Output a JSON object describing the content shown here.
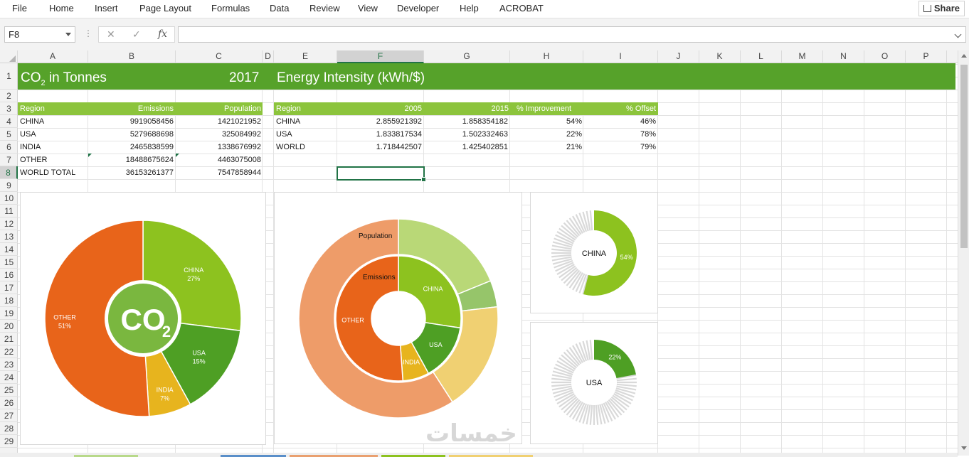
{
  "ribbon": {
    "tabs": [
      "File",
      "Home",
      "Insert",
      "Page Layout",
      "Formulas",
      "Data",
      "Review",
      "View",
      "Developer",
      "Help",
      "ACROBAT"
    ],
    "share": "Share"
  },
  "formula_bar": {
    "name_box": "F8",
    "cancel": "✕",
    "enter": "✓",
    "fx": "fx",
    "formula": ""
  },
  "columns": [
    "A",
    "B",
    "C",
    "D",
    "E",
    "F",
    "G",
    "H",
    "I",
    "J",
    "K",
    "L",
    "M",
    "N",
    "O",
    "P"
  ],
  "selected_column": "F",
  "rows": [
    "1",
    "2",
    "3",
    "4",
    "5",
    "6",
    "7",
    "8",
    "9",
    "10",
    "11",
    "12",
    "13",
    "14",
    "15",
    "16",
    "17",
    "18",
    "19",
    "20",
    "21",
    "22",
    "23",
    "24",
    "25",
    "26",
    "27",
    "28",
    "29"
  ],
  "selected_row": "8",
  "banner": {
    "co2_label": "CO",
    "co2_sub": "2",
    "co2_rest": " in Tonnes",
    "year": "2017",
    "energy_title": "Energy Intensity  (kWh/$)"
  },
  "emissions_table": {
    "headers": [
      "Region",
      "Emissions",
      "Population"
    ],
    "rows": [
      [
        "CHINA",
        "9919058456",
        "1421021952"
      ],
      [
        "USA",
        "5279688698",
        "325084992"
      ],
      [
        "INDIA",
        "2465838599",
        "1338676992"
      ],
      [
        "OTHER",
        "18488675624",
        "4463075008"
      ],
      [
        "WORLD TOTAL",
        "36153261377",
        "7547858944"
      ]
    ]
  },
  "intensity_table": {
    "headers": [
      "Region",
      "2005",
      "2015",
      "% Improvement",
      "% Offset"
    ],
    "rows": [
      [
        "CHINA",
        "2.855921392",
        "1.858354182",
        "54%",
        "46%"
      ],
      [
        "USA",
        "1.833817534",
        "1.502332463",
        "22%",
        "78%"
      ],
      [
        "WORLD",
        "1.718442507",
        "1.425402851",
        "21%",
        "79%"
      ]
    ]
  },
  "chart_data": [
    {
      "type": "pie",
      "title": "",
      "center_label": "CO",
      "center_sub": "2",
      "categories": [
        "CHINA",
        "USA",
        "INDIA",
        "OTHER"
      ],
      "values": [
        27,
        15,
        7,
        51
      ],
      "labels": [
        "27%",
        "15%",
        "7%",
        "51%"
      ],
      "colors": [
        "#8dc21f",
        "#4e9f24",
        "#e7b41e",
        "#e8641a"
      ]
    },
    {
      "type": "pie",
      "subtype": "doughnut",
      "title": "",
      "series": [
        {
          "name": "Emissions",
          "categories": [
            "CHINA",
            "USA",
            "INDIA",
            "OTHER"
          ],
          "values": [
            9919058456,
            5279688698,
            2465838599,
            18488675624
          ],
          "colors": [
            "#8dc21f",
            "#4e9f24",
            "#e7b41e",
            "#e8641a"
          ]
        },
        {
          "name": "Population",
          "categories": [
            "CHINA",
            "USA",
            "INDIA",
            "OTHER"
          ],
          "values": [
            1421021952,
            325084992,
            1338676992,
            4463075008
          ],
          "colors": [
            "#b9d877",
            "#96c56a",
            "#f0d072",
            "#ee9c69"
          ]
        }
      ]
    },
    {
      "type": "pie",
      "subtype": "doughnut",
      "title": "",
      "center_label": "CHINA",
      "values": [
        54,
        46
      ],
      "labels": [
        "54%",
        ""
      ],
      "colors": [
        "#8dc21f",
        "#d9d9d9"
      ]
    },
    {
      "type": "pie",
      "subtype": "doughnut",
      "title": "",
      "center_label": "USA",
      "values": [
        22,
        78
      ],
      "labels": [
        "22%",
        ""
      ],
      "colors": [
        "#4e9f24",
        "#d9d9d9"
      ]
    }
  ],
  "watermark": "خمسات"
}
